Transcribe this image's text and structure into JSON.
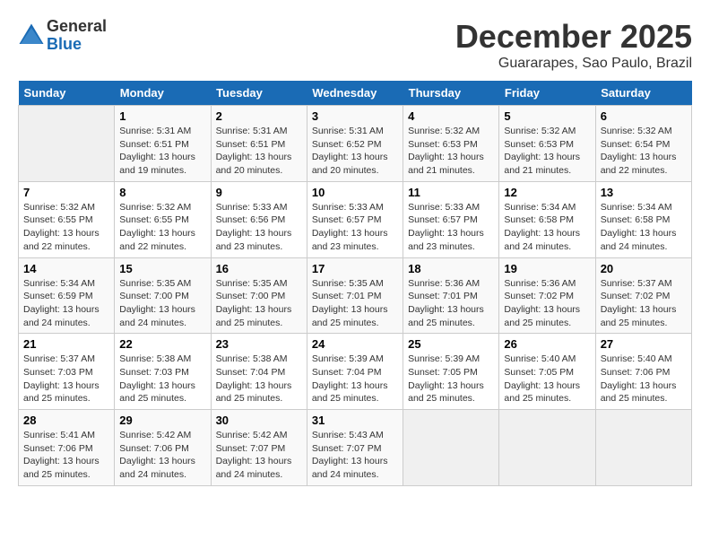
{
  "logo": {
    "general": "General",
    "blue": "Blue"
  },
  "title": "December 2025",
  "location": "Guararapes, Sao Paulo, Brazil",
  "weekdays": [
    "Sunday",
    "Monday",
    "Tuesday",
    "Wednesday",
    "Thursday",
    "Friday",
    "Saturday"
  ],
  "weeks": [
    [
      {
        "day": "",
        "info": ""
      },
      {
        "day": "1",
        "info": "Sunrise: 5:31 AM\nSunset: 6:51 PM\nDaylight: 13 hours\nand 19 minutes."
      },
      {
        "day": "2",
        "info": "Sunrise: 5:31 AM\nSunset: 6:51 PM\nDaylight: 13 hours\nand 20 minutes."
      },
      {
        "day": "3",
        "info": "Sunrise: 5:31 AM\nSunset: 6:52 PM\nDaylight: 13 hours\nand 20 minutes."
      },
      {
        "day": "4",
        "info": "Sunrise: 5:32 AM\nSunset: 6:53 PM\nDaylight: 13 hours\nand 21 minutes."
      },
      {
        "day": "5",
        "info": "Sunrise: 5:32 AM\nSunset: 6:53 PM\nDaylight: 13 hours\nand 21 minutes."
      },
      {
        "day": "6",
        "info": "Sunrise: 5:32 AM\nSunset: 6:54 PM\nDaylight: 13 hours\nand 22 minutes."
      }
    ],
    [
      {
        "day": "7",
        "info": "Sunrise: 5:32 AM\nSunset: 6:55 PM\nDaylight: 13 hours\nand 22 minutes."
      },
      {
        "day": "8",
        "info": "Sunrise: 5:32 AM\nSunset: 6:55 PM\nDaylight: 13 hours\nand 22 minutes."
      },
      {
        "day": "9",
        "info": "Sunrise: 5:33 AM\nSunset: 6:56 PM\nDaylight: 13 hours\nand 23 minutes."
      },
      {
        "day": "10",
        "info": "Sunrise: 5:33 AM\nSunset: 6:57 PM\nDaylight: 13 hours\nand 23 minutes."
      },
      {
        "day": "11",
        "info": "Sunrise: 5:33 AM\nSunset: 6:57 PM\nDaylight: 13 hours\nand 23 minutes."
      },
      {
        "day": "12",
        "info": "Sunrise: 5:34 AM\nSunset: 6:58 PM\nDaylight: 13 hours\nand 24 minutes."
      },
      {
        "day": "13",
        "info": "Sunrise: 5:34 AM\nSunset: 6:58 PM\nDaylight: 13 hours\nand 24 minutes."
      }
    ],
    [
      {
        "day": "14",
        "info": "Sunrise: 5:34 AM\nSunset: 6:59 PM\nDaylight: 13 hours\nand 24 minutes."
      },
      {
        "day": "15",
        "info": "Sunrise: 5:35 AM\nSunset: 7:00 PM\nDaylight: 13 hours\nand 24 minutes."
      },
      {
        "day": "16",
        "info": "Sunrise: 5:35 AM\nSunset: 7:00 PM\nDaylight: 13 hours\nand 25 minutes."
      },
      {
        "day": "17",
        "info": "Sunrise: 5:35 AM\nSunset: 7:01 PM\nDaylight: 13 hours\nand 25 minutes."
      },
      {
        "day": "18",
        "info": "Sunrise: 5:36 AM\nSunset: 7:01 PM\nDaylight: 13 hours\nand 25 minutes."
      },
      {
        "day": "19",
        "info": "Sunrise: 5:36 AM\nSunset: 7:02 PM\nDaylight: 13 hours\nand 25 minutes."
      },
      {
        "day": "20",
        "info": "Sunrise: 5:37 AM\nSunset: 7:02 PM\nDaylight: 13 hours\nand 25 minutes."
      }
    ],
    [
      {
        "day": "21",
        "info": "Sunrise: 5:37 AM\nSunset: 7:03 PM\nDaylight: 13 hours\nand 25 minutes."
      },
      {
        "day": "22",
        "info": "Sunrise: 5:38 AM\nSunset: 7:03 PM\nDaylight: 13 hours\nand 25 minutes."
      },
      {
        "day": "23",
        "info": "Sunrise: 5:38 AM\nSunset: 7:04 PM\nDaylight: 13 hours\nand 25 minutes."
      },
      {
        "day": "24",
        "info": "Sunrise: 5:39 AM\nSunset: 7:04 PM\nDaylight: 13 hours\nand 25 minutes."
      },
      {
        "day": "25",
        "info": "Sunrise: 5:39 AM\nSunset: 7:05 PM\nDaylight: 13 hours\nand 25 minutes."
      },
      {
        "day": "26",
        "info": "Sunrise: 5:40 AM\nSunset: 7:05 PM\nDaylight: 13 hours\nand 25 minutes."
      },
      {
        "day": "27",
        "info": "Sunrise: 5:40 AM\nSunset: 7:06 PM\nDaylight: 13 hours\nand 25 minutes."
      }
    ],
    [
      {
        "day": "28",
        "info": "Sunrise: 5:41 AM\nSunset: 7:06 PM\nDaylight: 13 hours\nand 25 minutes."
      },
      {
        "day": "29",
        "info": "Sunrise: 5:42 AM\nSunset: 7:06 PM\nDaylight: 13 hours\nand 24 minutes."
      },
      {
        "day": "30",
        "info": "Sunrise: 5:42 AM\nSunset: 7:07 PM\nDaylight: 13 hours\nand 24 minutes."
      },
      {
        "day": "31",
        "info": "Sunrise: 5:43 AM\nSunset: 7:07 PM\nDaylight: 13 hours\nand 24 minutes."
      },
      {
        "day": "",
        "info": ""
      },
      {
        "day": "",
        "info": ""
      },
      {
        "day": "",
        "info": ""
      }
    ]
  ]
}
